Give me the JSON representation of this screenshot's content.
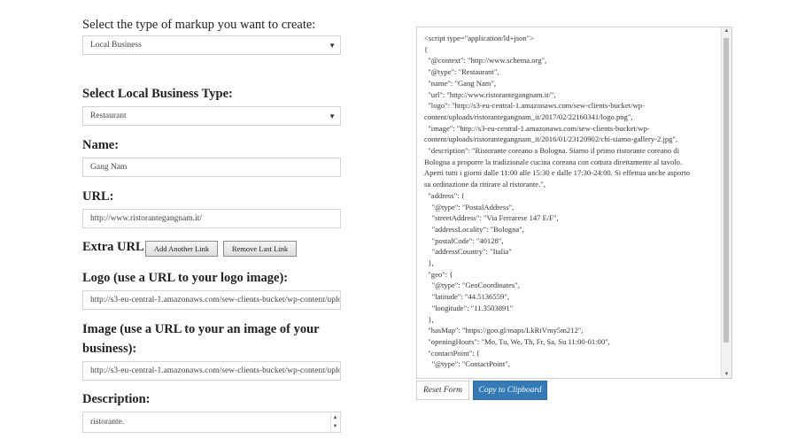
{
  "form": {
    "markup_type_label": "Select the type of markup you want to create:",
    "markup_type_value": "Local Business",
    "business_type_label": "Select Local Business Type:",
    "business_type_value": "Restaurant",
    "name_label": "Name:",
    "name_value": "Gang Nam",
    "url_label": "URL:",
    "url_value": "http://www.ristorantegangnam.it/",
    "extra_url_label": "Extra URL:",
    "add_link_label": "Add Another Link",
    "remove_link_label": "Remove Last Link",
    "logo_label": "Logo (use a URL to your logo image):",
    "logo_value": "http://s3-eu-central-1.amazonaws.com/sew-clients-bucket/wp-content/uploads/",
    "image_label_line1": "Image (use a URL to your an image of your",
    "image_label_line2": "business):",
    "image_value": "http://s3-eu-central-1.amazonaws.com/sew-clients-bucket/wp-content/uploads/",
    "description_label": "Description:",
    "description_value": "ristorante."
  },
  "output": {
    "code_lines": [
      "<script type=\"application/ld+json\">",
      "{",
      "  \"@context\": \"http://www.schema.org\",",
      "  \"@type\": \"Restaurant\",",
      "  \"name\": \"Gang Nam\",",
      "  \"url\": \"http://www.ristorantegangnam.it/\",",
      "  \"logo\": \"http://s3-eu-central-1.amazonaws.com/sew-clients-bucket/wp-",
      "content/uploads/ristorantegangnam_it/2017/02/22160341/logo.png\",",
      "  \"image\": \"http://s3-eu-central-1.amazonaws.com/sew-clients-bucket/wp-",
      "content/uploads/ristorantegangnam_it/2016/01/23120902/chi-siamo-gallery-2.jpg\",",
      "  \"description\": \"Ristorante coreano a Bologna. Siamo il primo ristorante coreano di",
      "Bologna a proporre la tradizionale cucina coreana con cottura direttamente al tavolo.",
      "Aperti tutti i giorni dalle 11:00 alle 15:30 e dalle 17:30-24:00. Si effettua anche asporto",
      "su ordinazione da ritirare al ristorante.\",",
      "  \"address\": {",
      "    \"@type\": \"PostalAddress\",",
      "    \"streetAddress\": \"Via Ferrarese 147 E/F\",",
      "    \"addressLocality\": \"Bologna\",",
      "    \"postalCode\": \"40128\",",
      "    \"addressCountry\": \"Italia\"",
      "  },",
      "  \"geo\": {",
      "    \"@type\": \"GeoCoordinates\",",
      "    \"latitude\": \"44.5136559\",",
      "    \"longitude\": \"11.3503891\"",
      "  },",
      "  \"hasMap\": \"https://goo.gl/maps/LkRtVmy5m212\",",
      "  \"openingHours\": \"Mo, Tu, We, Th, Fr, Sa, Su 11:00-01:00\",",
      "  \"contactPoint\": {",
      "    \"@type\": \"ContactPoint\","
    ],
    "reset_label": "Reset Form",
    "copy_label": "Copy to Clipboard"
  }
}
